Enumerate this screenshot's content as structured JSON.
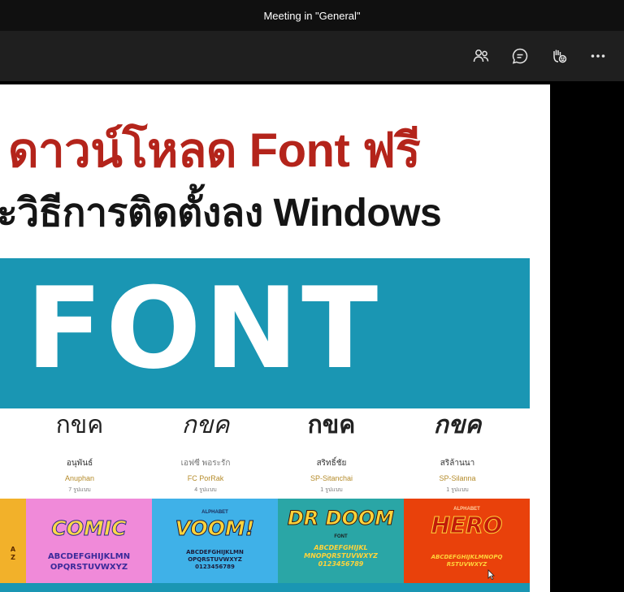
{
  "window": {
    "title": "Meeting in \"General\""
  },
  "toolbar": {
    "buttons": [
      {
        "name": "participants",
        "icon": "people-icon"
      },
      {
        "name": "chat",
        "icon": "chat-icon"
      },
      {
        "name": "reactions",
        "icon": "raise-hand-icon"
      },
      {
        "name": "more",
        "icon": "more-icon"
      }
    ]
  },
  "slide": {
    "heading1": "ดาวน์โหลด Font ฟรี",
    "heading2": "ะวิธีการติดตั้งลง Windows",
    "banner_text": "FONT",
    "banner_color": "#1a96b3",
    "heading1_color": "#b4241b",
    "samples": [
      {
        "glyph": "กขค",
        "thai_name": "อนุพันธ์",
        "eng_name": "Anuphan",
        "count": "7 รูปแบบ"
      },
      {
        "glyph": "กขค",
        "thai_name": "เอฟซี พอระรัก",
        "eng_name": "FC PorRak",
        "count": "4 รูปแบบ"
      },
      {
        "glyph": "กขค",
        "thai_name": "สริทธิ์ชัย",
        "eng_name": "SP-Sitanchai",
        "count": "1 รูปแบบ"
      },
      {
        "glyph": "กขค",
        "thai_name": "สริล้านนา",
        "eng_name": "SP-Silanna",
        "count": "1 รูปแบบ"
      }
    ],
    "tiles": [
      {
        "name": "partial",
        "big": "",
        "top_small": "",
        "bottom_small": "",
        "alpha": "A\nZ",
        "bg": "#f2b12a"
      },
      {
        "name": "comic",
        "big": "COMIC",
        "top_small": "",
        "bottom_small": "",
        "alpha": "ABCDEFGHIJKLMN\nOPQRSTUVWXYZ",
        "bg": "#f08ad9"
      },
      {
        "name": "voom",
        "big": "VOOM!",
        "top_small": "ALPHABET",
        "bottom_small": "",
        "alpha": "ABCDEFGHIJKLMN\nOPQRSTUVWXYZ\n0123456789",
        "bg": "#3fb1e8"
      },
      {
        "name": "dr-doom",
        "big": "DR DOOM",
        "top_small": "",
        "bottom_small": "FONT",
        "alpha": "ABCDEFGHIJKL\nMNOPQRSTUVWXYZ\n0123456789",
        "bg": "#2aa6a6"
      },
      {
        "name": "hero",
        "big": "HERO",
        "top_small": "ALPHABET",
        "bottom_small": "",
        "alpha": "ABCDEFGHIJKLMNOPQ\nRSTUVWXYZ",
        "bg": "#e9410b"
      }
    ]
  }
}
